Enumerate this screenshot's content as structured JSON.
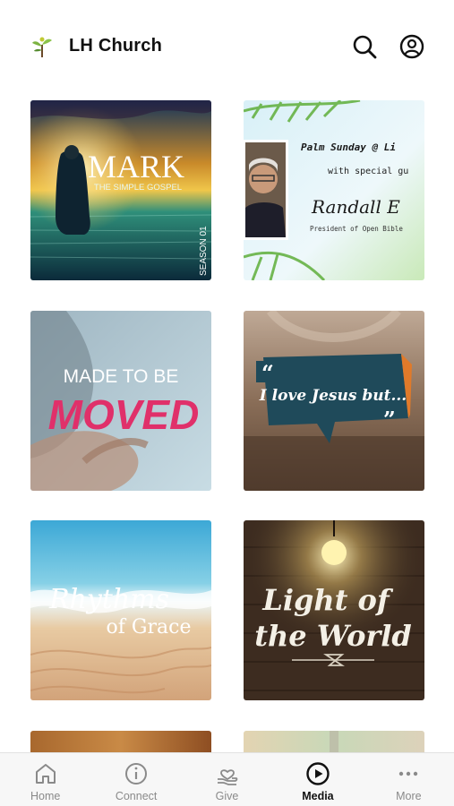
{
  "header": {
    "title": "LH Church",
    "icons": [
      "sprout-logo-icon",
      "search-icon",
      "profile-icon"
    ]
  },
  "tiles": [
    {
      "title": "MARK",
      "subtitle": "THE SIMPLE GOSPEL",
      "season": "SEASON 01"
    },
    {
      "line1": "Palm Sunday @ Li",
      "line2": "with special gu",
      "name": "Randall E",
      "role": "President of Open Bible"
    },
    {
      "line1": "MADE TO BE",
      "line2": "MOVED"
    },
    {
      "quote_open": "“",
      "title": "I love Jesus but...",
      "quote_close": "”"
    },
    {
      "line1": "Rhythms",
      "line2": "of Grace"
    },
    {
      "line1": "Light of",
      "line2": "the World"
    }
  ],
  "tabbar": {
    "tabs": [
      {
        "label": "Home",
        "icon": "home-icon"
      },
      {
        "label": "Connect",
        "icon": "info-icon"
      },
      {
        "label": "Give",
        "icon": "give-heart-hand-icon"
      },
      {
        "label": "Media",
        "icon": "play-icon"
      },
      {
        "label": "More",
        "icon": "more-dots-icon"
      }
    ],
    "active": "Media"
  }
}
